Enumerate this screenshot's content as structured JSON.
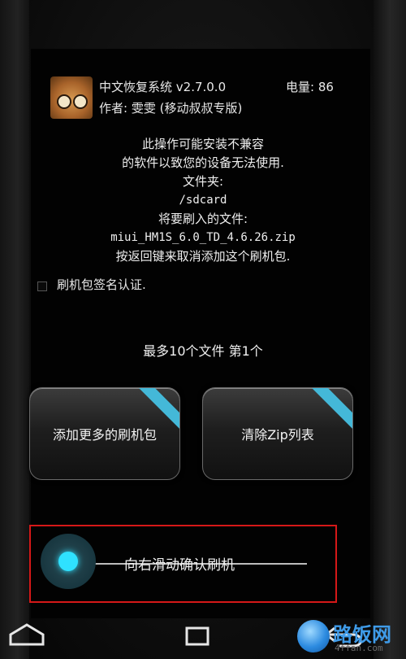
{
  "header": {
    "app_title": "中文恢复系统 v2.7.0.0",
    "battery_label": "电量: 86",
    "author_label": "作者: 雯雯 (移动叔叔专版)"
  },
  "message": {
    "lines": [
      "此操作可能安装不兼容",
      "的软件以致您的设备无法使用.",
      "文件夹:",
      "/sdcard",
      "将要刷入的文件:",
      "miui_HM1S_6.0_TD_4.6.26.zip",
      "按返回键来取消添加这个刷机包."
    ]
  },
  "signature_check": {
    "label": "刷机包签名认证.",
    "checked": false
  },
  "file_count": "最多10个文件  第1个",
  "buttons": {
    "add_more": "添加更多的刷机包",
    "clear_zip": "清除Zip列表"
  },
  "slider": {
    "label": "向右滑动确认刷机",
    "accent": "#2fe1ff",
    "highlight_border": "#d51818"
  },
  "nav_icons": [
    "home-icon",
    "recent-apps-icon",
    "back-icon"
  ],
  "watermark": {
    "text": "路饭网",
    "sub": "4ffan.com"
  }
}
